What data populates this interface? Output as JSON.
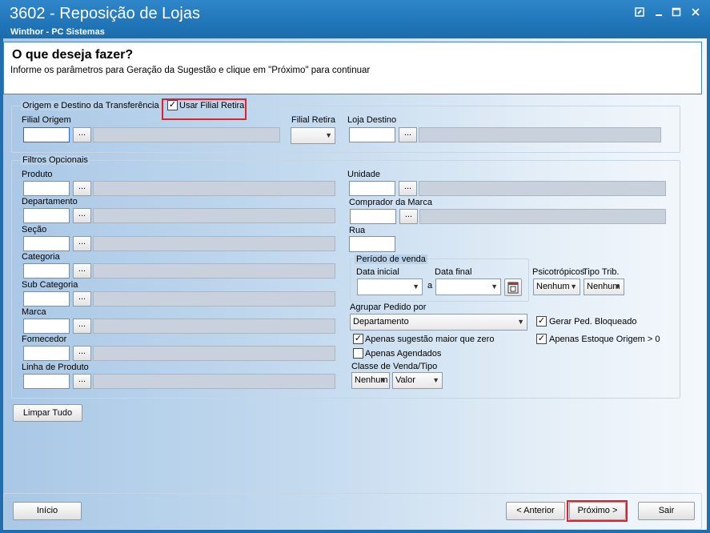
{
  "window": {
    "title": "3602 - Reposição de Lojas",
    "subtitle": "Winthor - PC Sistemas"
  },
  "header": {
    "title": "O que deseja fazer?",
    "description": "Informe os parâmetros para Geração da Sugestão e clique em \"Próximo\" para continuar"
  },
  "origem": {
    "group_label": "Origem e Destino da Transferência",
    "usar_filial_retira": {
      "label": "Usar Filial Retira",
      "checked": true
    },
    "filial_origem_label": "Filial Origem",
    "filial_retira_label": "Filial Retira",
    "loja_destino_label": "Loja Destino"
  },
  "filtros": {
    "group_label": "Filtros Opcionais",
    "left_fields": [
      "Produto",
      "Departamento",
      "Seção",
      "Categoria",
      "Sub Categoria",
      "Marca",
      "Fornecedor",
      "Linha de Produto"
    ],
    "unidade_label": "Unidade",
    "comprador_label": "Comprador da Marca",
    "rua_label": "Rua",
    "periodo": {
      "label": "Período de venda",
      "inicial_label": "Data inicial",
      "a_label": "a",
      "final_label": "Data final"
    },
    "psicotropicos": {
      "label": "Psicotrópicos",
      "value": "Nenhum"
    },
    "tipo_trib": {
      "label": "Tipo Trib.",
      "value": "Nenhum"
    },
    "agrupar": {
      "label": "Agrupar Pedido por",
      "value": "Departamento"
    },
    "gerar_bloqueado": {
      "label": "Gerar Ped. Bloqueado",
      "checked": true
    },
    "apenas_sugestao": {
      "label": "Apenas sugestão maior que zero",
      "checked": true
    },
    "apenas_estoque": {
      "label": "Apenas Estoque Origem > 0",
      "checked": true
    },
    "apenas_agendados": {
      "label": "Apenas Agendados",
      "checked": false
    },
    "classe": {
      "label": "Classe de Venda/Tipo",
      "value1": "Nenhum",
      "value2": "Valor"
    }
  },
  "buttons": {
    "limpar": "Limpar Tudo",
    "inicio": "Início",
    "anterior": "< Anterior",
    "proximo": "Próximo >",
    "sair": "Sair"
  },
  "colors": {
    "highlight": "#e0202a",
    "title_bar": "#2076b8"
  }
}
